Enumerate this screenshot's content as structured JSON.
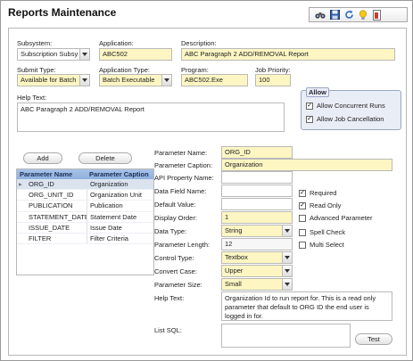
{
  "window": {
    "title": "Reports Maintenance"
  },
  "toolbar": {
    "icons": [
      "binoculars-icon",
      "save-icon",
      "refresh-icon",
      "lightbulb-icon",
      "exit-icon"
    ]
  },
  "header": {
    "subsystem_label": "Subsystem:",
    "subsystem_value": "Subscription Subsyst",
    "application_label": "Application:",
    "application_value": "ABC502",
    "description_label": "Description:",
    "description_value": "ABC Paragraph 2 ADD/REMOVAL Report",
    "submit_type_label": "Submit Type:",
    "submit_type_value": "Available for Batch s",
    "app_type_label": "Application Type:",
    "app_type_value": "Batch Executable",
    "program_label": "Program:",
    "program_value": "ABC502.Exe",
    "job_priority_label": "Job Priority:",
    "job_priority_value": "100",
    "allow_title": "Allow",
    "allow_concurrent_label": "Allow Concurrent Runs",
    "allow_concurrent_checked": true,
    "allow_cancel_label": "Allow Job Cancellation",
    "allow_cancel_checked": true,
    "help_text_label": "Help Text:",
    "help_text_value": "ABC Paragraph 2 ADD/REMOVAL Report"
  },
  "params_grid": {
    "add_label": "Add",
    "delete_label": "Delete",
    "col_name": "Parameter Name",
    "col_caption": "Parameter Caption",
    "rows": [
      {
        "name": "ORG_ID",
        "caption": "Organization"
      },
      {
        "name": "ORG_UNIT_ID",
        "caption": "Organization Unit"
      },
      {
        "name": "PUBLICATION",
        "caption": "Publication"
      },
      {
        "name": "STATEMENT_DATE",
        "caption": "Statement Date"
      },
      {
        "name": "ISSUE_DATE",
        "caption": "Issue Date"
      },
      {
        "name": "FILTER",
        "caption": "Filter Criteria"
      }
    ]
  },
  "param_detail": {
    "name_label": "Parameter Name:",
    "name_value": "ORG_ID",
    "caption_label": "Parameter Caption:",
    "caption_value": "Organization",
    "api_label": "API Property Name:",
    "api_value": "",
    "datafield_label": "Data Field Name:",
    "datafield_value": "",
    "default_label": "Default Value:",
    "default_value": "",
    "order_label": "Display Order:",
    "order_value": "1",
    "datatype_label": "Data Type:",
    "datatype_value": "String",
    "length_label": "Parameter Length:",
    "length_value": "12",
    "control_label": "Control Type:",
    "control_value": "Textbox",
    "convert_label": "Convert Case:",
    "convert_value": "Upper",
    "size_label": "Parameter Size:",
    "size_value": "Small",
    "help_label": "Help Text:",
    "help_value": "Organization Id to run report for. This is a read only parameter that default to ORG ID the end user is logged in for.",
    "listsql_label": "List SQL:",
    "listsql_value": "",
    "test_label": "Test",
    "required_label": "Required",
    "required_checked": true,
    "readonly_label": "Read Only",
    "readonly_checked": true,
    "advanced_label": "Advanced Parameter",
    "advanced_checked": false,
    "spell_label": "Spell Check",
    "spell_checked": false,
    "multi_label": "Multi Select",
    "multi_checked": false
  }
}
